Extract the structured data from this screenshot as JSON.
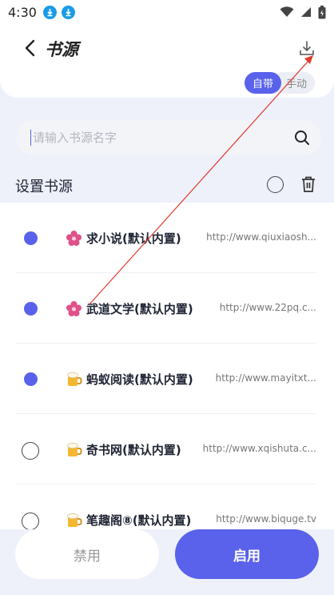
{
  "status": {
    "time": "4:30"
  },
  "header": {
    "title": "书源",
    "tab_builtin": "自带",
    "tab_manual": "手动"
  },
  "search": {
    "placeholder": "请输入书源名字"
  },
  "section": {
    "title": "设置书源"
  },
  "sources": [
    {
      "name": "求小说(默认内置)",
      "url": "http://www.qiuxiaosh...",
      "selected": true,
      "icon": "flower-icon"
    },
    {
      "name": "武道文学(默认内置)",
      "url": "http://www.22pq.c...",
      "selected": true,
      "icon": "flower-icon"
    },
    {
      "name": "蚂蚁阅读(默认内置)",
      "url": "http://www.mayitxt...",
      "selected": true,
      "icon": "beer-mug-icon"
    },
    {
      "name": "奇书网(默认内置)",
      "url": "http://www.xqishuta.c...",
      "selected": false,
      "icon": "beer-mug-icon"
    },
    {
      "name": "笔趣阁⑧(默认内置)",
      "url": "http://www.biquge.tv",
      "selected": false,
      "icon": "beer-mug-icon"
    }
  ],
  "actions": {
    "disable_label": "禁用",
    "enable_label": "启用"
  },
  "colors": {
    "accent": "#5a61ea",
    "background": "#eef1fa"
  }
}
